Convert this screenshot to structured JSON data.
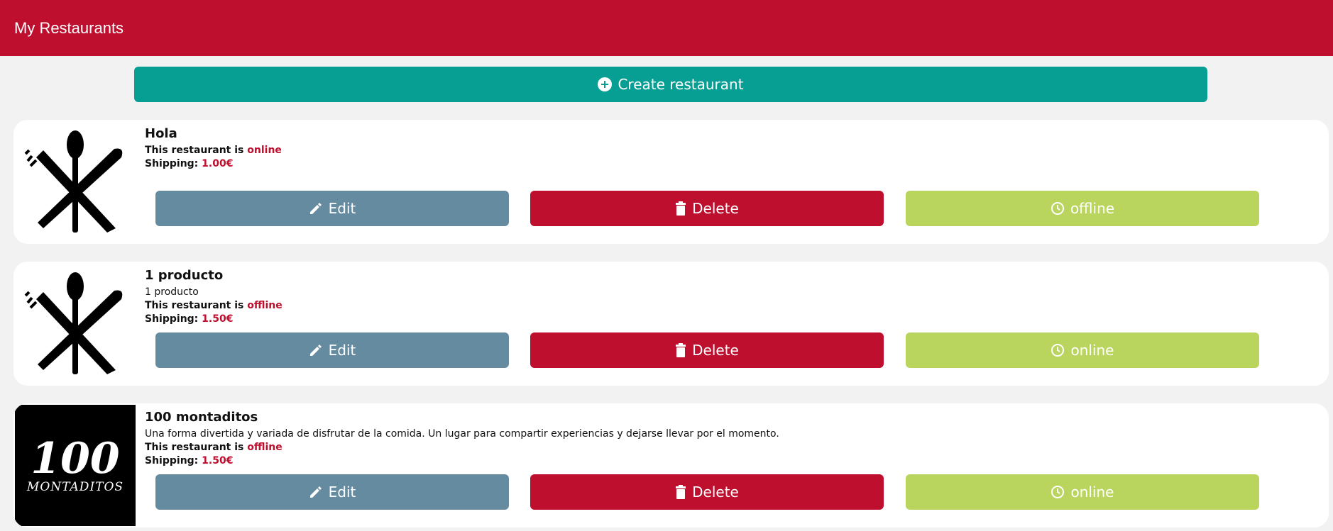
{
  "header": {
    "title": "My Restaurants"
  },
  "create_button": {
    "label": "Create restaurant"
  },
  "status_prefix": "This restaurant is ",
  "shipping_prefix": "Shipping: ",
  "restaurants": [
    {
      "name": "Hola",
      "description": "",
      "status": "online",
      "shipping": "1.00€",
      "image": "cutlery",
      "edit_label": "Edit",
      "delete_label": "Delete",
      "toggle_label": "offline"
    },
    {
      "name": "1 producto",
      "description": "1 producto",
      "status": "offline",
      "shipping": "1.50€",
      "image": "cutlery",
      "edit_label": "Edit",
      "delete_label": "Delete",
      "toggle_label": "online"
    },
    {
      "name": "100 montaditos",
      "description": "Una forma divertida y variada de disfrutar de la comida. Un lugar para compartir experiencias y dejarse llevar por el momento.",
      "status": "offline",
      "shipping": "1.50€",
      "image": "100-montaditos-logo",
      "logo_text": "100 MONTADITOS",
      "edit_label": "Edit",
      "delete_label": "Delete",
      "toggle_label": "online"
    }
  ],
  "colors": {
    "brand": "#be0f2e",
    "create": "#079f93",
    "edit": "#658ba0",
    "toggle": "#b9d55e"
  }
}
